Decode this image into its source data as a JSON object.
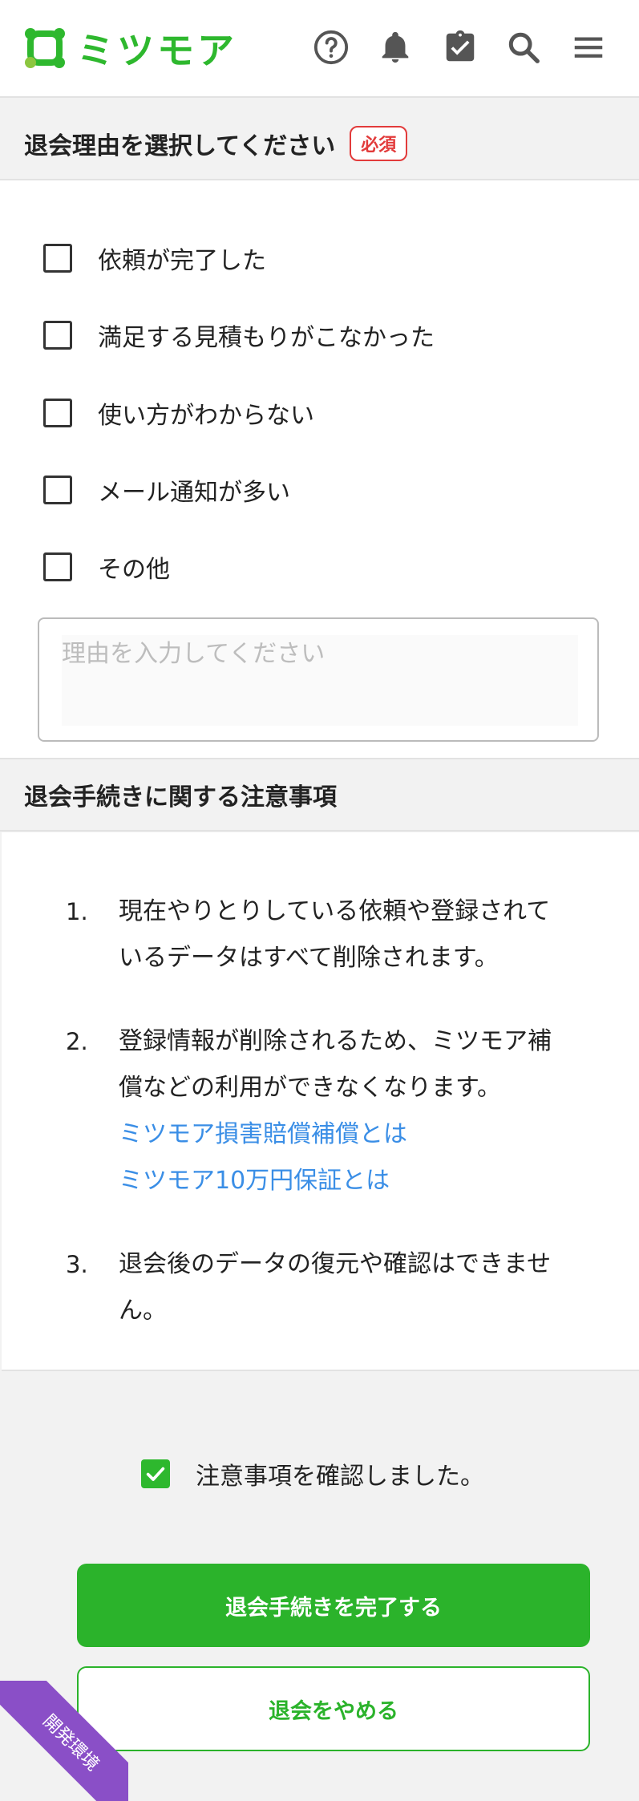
{
  "header": {
    "brand": "ミツモア",
    "icons": [
      "help-icon",
      "bell-icon",
      "clipboard-check-icon",
      "search-icon",
      "menu-icon"
    ],
    "brand_color": "#2eb82e"
  },
  "reasons_section": {
    "title": "退会理由を選択してください",
    "required_badge": "必須",
    "options": [
      {
        "label": "依頼が完了した",
        "checked": false
      },
      {
        "label": "満足する見積もりがこなかった",
        "checked": false
      },
      {
        "label": "使い方がわからない",
        "checked": false
      },
      {
        "label": "メール通知が多い",
        "checked": false
      },
      {
        "label": "その他",
        "checked": false
      }
    ],
    "reason_input": {
      "value": "",
      "placeholder": "理由を入力してください"
    }
  },
  "notes_section": {
    "title": "退会手続きに関する注意事項",
    "items": [
      {
        "num": "1.",
        "line1": "現在やりとりしている依頼や登録されて",
        "line2": "いるデータはすべて削除されます。"
      },
      {
        "num": "2.",
        "line1": "登録情報が削除されるため、ミツモア補",
        "line2": "償などの利用ができなくなります。",
        "links": [
          "ミツモア損害賠償補償とは",
          "ミツモア10万円保証とは"
        ]
      },
      {
        "num": "3.",
        "line1": "退会後のデータの復元や確認はできませ",
        "line2": "ん。"
      }
    ],
    "link_color": "#3a8ee6"
  },
  "confirm": {
    "label": "注意事項を確認しました。",
    "checked": true
  },
  "buttons": {
    "complete": "退会手続きを完了する",
    "cancel": "退会をやめる",
    "accent": "#2bb32b"
  },
  "dev_ribbon": {
    "label": "開発環境",
    "color": "#8a4fc7"
  }
}
